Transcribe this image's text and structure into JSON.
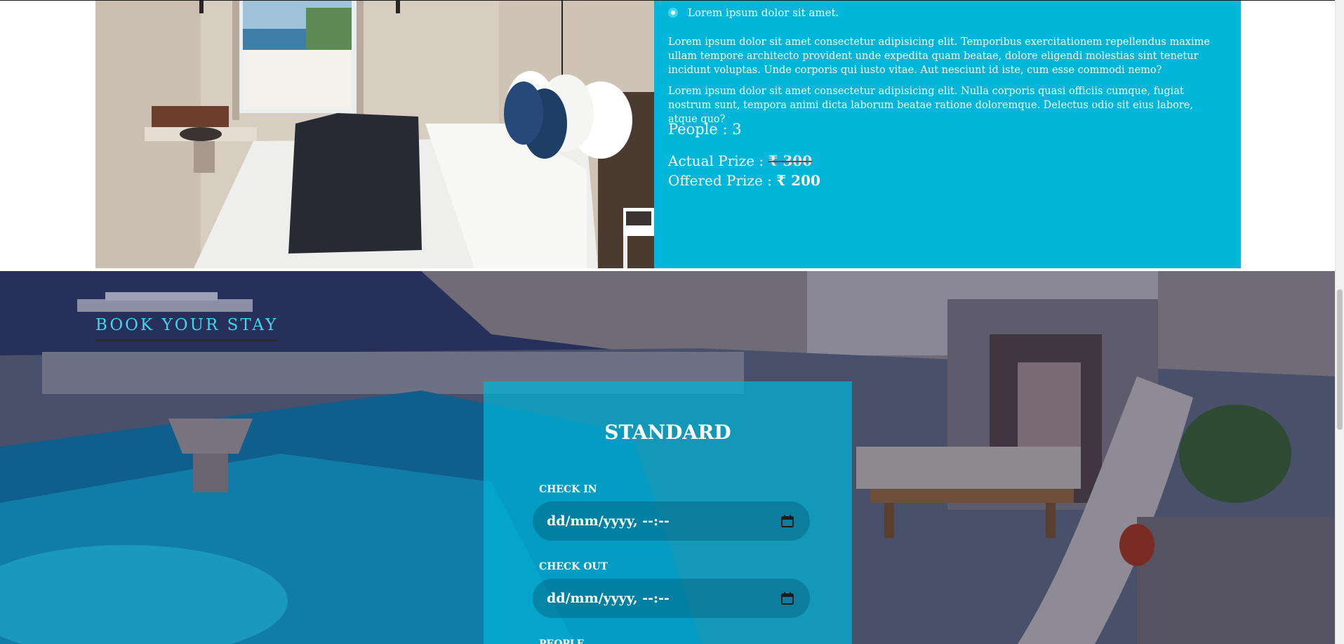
{
  "room": {
    "bullet_text": "Lorem ipsum dolor sit amet.",
    "paragraph_1": "Lorem ipsum dolor sit amet consectetur adipisicing elit. Temporibus exercitationem repellendus maxime ullam tempore architecto provident unde expedita quam beatae, dolore eligendi molestias sint tenetur incidunt voluptas. Unde corporis qui iusto vitae. Aut nesciunt id iste, cum esse commodi nemo?",
    "paragraph_2": "Lorem ipsum dolor sit amet consectetur adipisicing elit. Nulla corporis quasi officiis cumque, fugiat nostrum sunt, tempora animi dicta laborum beatae ratione doloremque. Delectus odio sit eius labore, atque quo?",
    "people_label": "People : 3",
    "actual_label": "Actual Prize : ",
    "actual_price": "₹ 300",
    "offered_label": "Offered Prize : ",
    "offered_price": "₹ 200"
  },
  "booking": {
    "section_title": "BOOK YOUR STAY",
    "card_title": "STANDARD",
    "check_in_label": "CHECK IN",
    "check_in_value": "dd/mm/yyyy, --:--",
    "check_out_label": "CHECK OUT",
    "check_out_value": "dd/mm/yyyy, --:--",
    "people_label": "PEOPLE"
  },
  "colors": {
    "accent": "#01b6d9",
    "title_accent": "#3fd6ee"
  },
  "icons": [
    "bullet-icon",
    "calendar-icon"
  ]
}
